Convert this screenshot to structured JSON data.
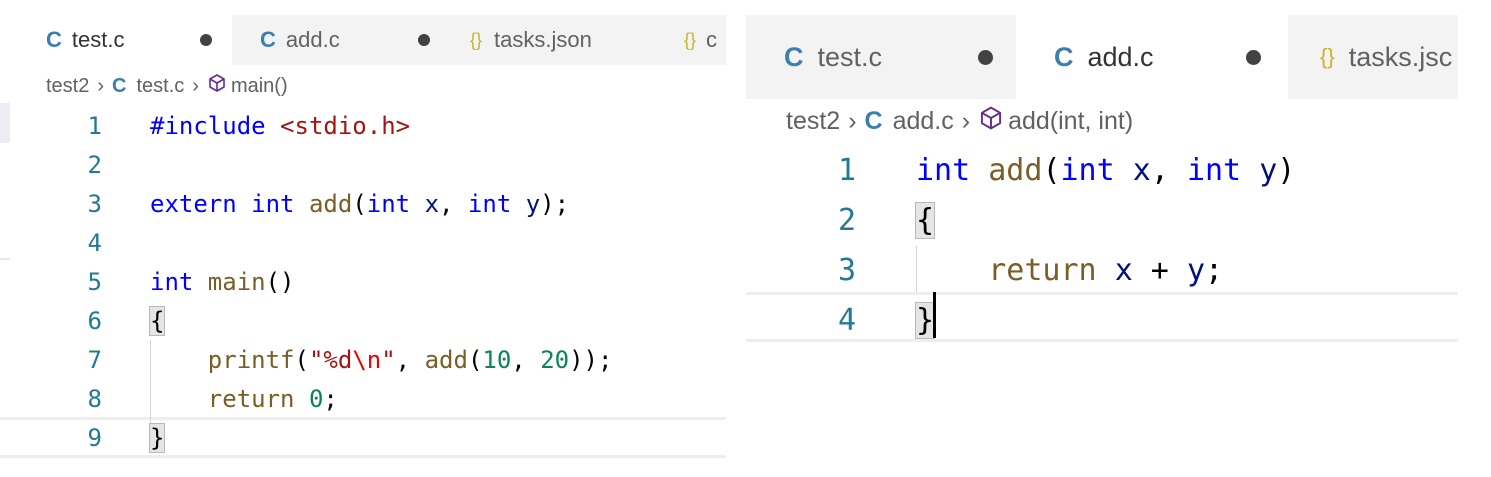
{
  "left_editor": {
    "tabs": [
      {
        "type_icon": "C",
        "name": "test.c",
        "modified_dot": true,
        "active": true
      },
      {
        "type_icon": "C",
        "name": "add.c",
        "modified_dot": true,
        "active": false
      },
      {
        "type_icon": "{}",
        "name": "tasks.json",
        "modified_dot": false,
        "active": false
      },
      {
        "type_icon": "{}",
        "name": "c",
        "modified_dot": false,
        "active": false
      }
    ],
    "breadcrumb": {
      "folder": "test2",
      "file_icon": "C",
      "file": "test.c",
      "symbol_icon": "cube-icon",
      "symbol": "main()"
    },
    "line_numbers": [
      "1",
      "2",
      "3",
      "4",
      "5",
      "6",
      "7",
      "8",
      "9"
    ],
    "lines": [
      [
        [
          "pp",
          "#include "
        ],
        [
          "inc",
          "<stdio.h>"
        ]
      ],
      [],
      [
        [
          "kw",
          "extern "
        ],
        [
          "kw",
          "int "
        ],
        [
          "fn",
          "add"
        ],
        [
          "plain",
          "("
        ],
        [
          "kw",
          "int "
        ],
        [
          "var",
          "x"
        ],
        [
          "plain",
          ", "
        ],
        [
          "kw",
          "int "
        ],
        [
          "var",
          "y"
        ],
        [
          "plain",
          ");"
        ]
      ],
      [],
      [
        [
          "kw",
          "int "
        ],
        [
          "fn",
          "main"
        ],
        [
          "plain",
          "()"
        ]
      ],
      [
        [
          "brm",
          "{"
        ]
      ],
      [
        [
          "plain",
          "    "
        ],
        [
          "fn",
          "printf"
        ],
        [
          "plain",
          "("
        ],
        [
          "str",
          "\"%d"
        ],
        [
          "esc",
          "\\n"
        ],
        [
          "str",
          "\""
        ],
        [
          "plain",
          ", "
        ],
        [
          "fn",
          "add"
        ],
        [
          "plain",
          "("
        ],
        [
          "num",
          "10"
        ],
        [
          "plain",
          ", "
        ],
        [
          "num",
          "20"
        ],
        [
          "plain",
          "));"
        ]
      ],
      [
        [
          "plain",
          "    "
        ],
        [
          "fn",
          "return "
        ],
        [
          "num",
          "0"
        ],
        [
          "plain",
          ";"
        ]
      ],
      [
        [
          "brm",
          "}"
        ]
      ]
    ]
  },
  "right_editor": {
    "tabs": [
      {
        "type_icon": "C",
        "name": "test.c",
        "modified_dot": true,
        "active": false
      },
      {
        "type_icon": "C",
        "name": "add.c",
        "modified_dot": true,
        "active": true
      },
      {
        "type_icon": "{}",
        "name": "tasks.jsc",
        "modified_dot": false,
        "active": false
      }
    ],
    "breadcrumb": {
      "folder": "test2",
      "file_icon": "C",
      "file": "add.c",
      "symbol_icon": "cube-icon",
      "symbol": "add(int, int)"
    },
    "line_numbers": [
      "1",
      "2",
      "3",
      "4"
    ],
    "lines": [
      [
        [
          "kw",
          "int "
        ],
        [
          "fn",
          "add"
        ],
        [
          "plain",
          "("
        ],
        [
          "kw",
          "int "
        ],
        [
          "var",
          "x"
        ],
        [
          "plain",
          ", "
        ],
        [
          "kw",
          "int "
        ],
        [
          "var",
          "y"
        ],
        [
          "plain",
          ")"
        ]
      ],
      [
        [
          "brm",
          "{"
        ]
      ],
      [
        [
          "plain",
          "    "
        ],
        [
          "fn",
          "return "
        ],
        [
          "var",
          "x"
        ],
        [
          "plain",
          " + "
        ],
        [
          "var",
          "y"
        ],
        [
          "plain",
          ";"
        ]
      ],
      [
        [
          "brm",
          "}"
        ]
      ]
    ]
  }
}
